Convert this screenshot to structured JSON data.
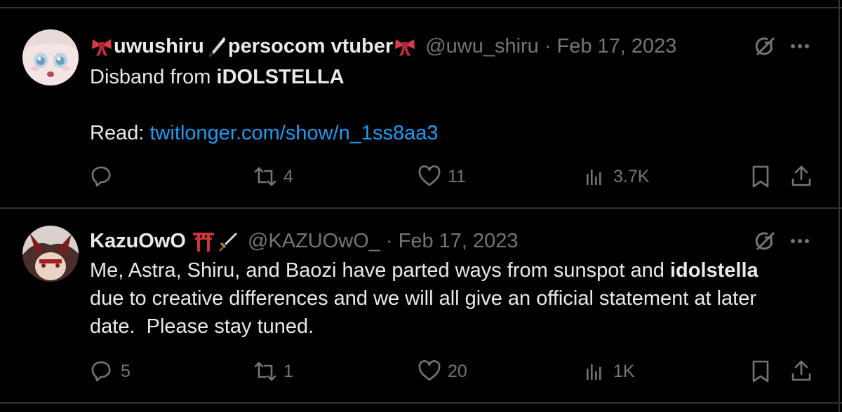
{
  "tweets": [
    {
      "display_name": "uwushiru",
      "display_name_suffix": "persocom vtuber",
      "handle": "@uwu_shiru",
      "date": "Feb 17, 2023",
      "text_prefix": "Disband from ",
      "text_bold": "iDOLSTELLA",
      "read_label": "Read: ",
      "link": "twitlonger.com/show/n_1ss8aa3",
      "reply_count": "",
      "retweet_count": "4",
      "like_count": "11",
      "view_count": "3.7K"
    },
    {
      "display_name": "KazuOwO",
      "handle": "@KAZUOwO_",
      "date": "Feb 17, 2023",
      "text_prefix": "Me, Astra, Shiru, and Baozi have parted ways from sunspot and ",
      "text_bold": "idolstella",
      "text_line2": "due to creative differences and we will all give an official statement at later",
      "text_line3": "date.  Please stay tuned.",
      "reply_count": "5",
      "retweet_count": "1",
      "like_count": "20",
      "view_count": "1K"
    }
  ],
  "colors": {
    "background": "#000000",
    "text": "#e7e9ea",
    "secondary": "#71767b",
    "link": "#1d9bf0",
    "border": "#2f3336"
  },
  "icons": [
    "ribbon-emoji-icon",
    "knife-emoji-icon",
    "torii-gate-emoji-icon",
    "dagger-emoji-icon",
    "grok-icon",
    "more-icon",
    "reply-icon",
    "retweet-icon",
    "like-icon",
    "views-icon",
    "bookmark-icon",
    "share-icon"
  ]
}
